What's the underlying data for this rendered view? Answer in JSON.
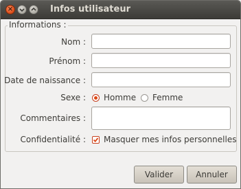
{
  "window": {
    "title": "Infos utilisateur",
    "buttons": [
      "close-icon",
      "minimize-icon",
      "maximize-icon"
    ],
    "accent_color": "#dd4814"
  },
  "form": {
    "frame_label": "Informations :",
    "nom_label": "Nom :",
    "nom_value": "",
    "prenom_label": "Prénom :",
    "prenom_value": "",
    "date_label": "Date de naissance :",
    "date_value": "",
    "sexe_label": "Sexe :",
    "sexe_options": [
      {
        "label": "Homme",
        "selected": true
      },
      {
        "label": "Femme",
        "selected": false
      }
    ],
    "commentaires_label": "Commentaires :",
    "commentaires_value": "",
    "confidentialite_label": "Confidentialité :",
    "confidentialite_checkbox": {
      "label": "Masquer mes infos personnelles",
      "checked": true
    }
  },
  "actions": {
    "validate_label": "Valider",
    "cancel_label": "Annuler"
  }
}
